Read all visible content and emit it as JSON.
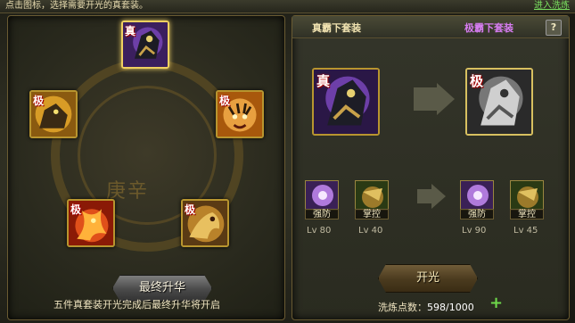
{
  "hint": {
    "text": "点击图标，选择需要开光的真套装。",
    "link": "进入洗炼"
  },
  "left": {
    "emblem": "庚辛",
    "slots": [
      {
        "badge": "真",
        "theme": "purple",
        "selected": true
      },
      {
        "badge": "极",
        "theme": "gold"
      },
      {
        "badge": "极",
        "theme": "tiger"
      },
      {
        "badge": "极",
        "theme": "fire"
      },
      {
        "badge": "极",
        "theme": "dragon"
      }
    ],
    "final_button": "最终升华",
    "note": "五件真套装开光完成后最终升华将开启"
  },
  "right": {
    "tab_current": "真霸下套装",
    "tab_target": "极霸下套装",
    "help": "?",
    "current_badge": "真",
    "target_badge": "极",
    "skills_before": [
      {
        "name": "强防",
        "lv": "Lv 80"
      },
      {
        "name": "掌控",
        "lv": "Lv 40"
      }
    ],
    "skills_after": [
      {
        "name": "强防",
        "lv": "Lv 90"
      },
      {
        "name": "掌控",
        "lv": "Lv 45"
      }
    ],
    "open_button": "开光",
    "points_label": "洗炼点数：",
    "points_value": "598/1000",
    "plus": "+"
  },
  "colors": {
    "gold_border": "#b8952f",
    "purple_tab": "#d67cf0",
    "green_link": "#7ae060"
  }
}
